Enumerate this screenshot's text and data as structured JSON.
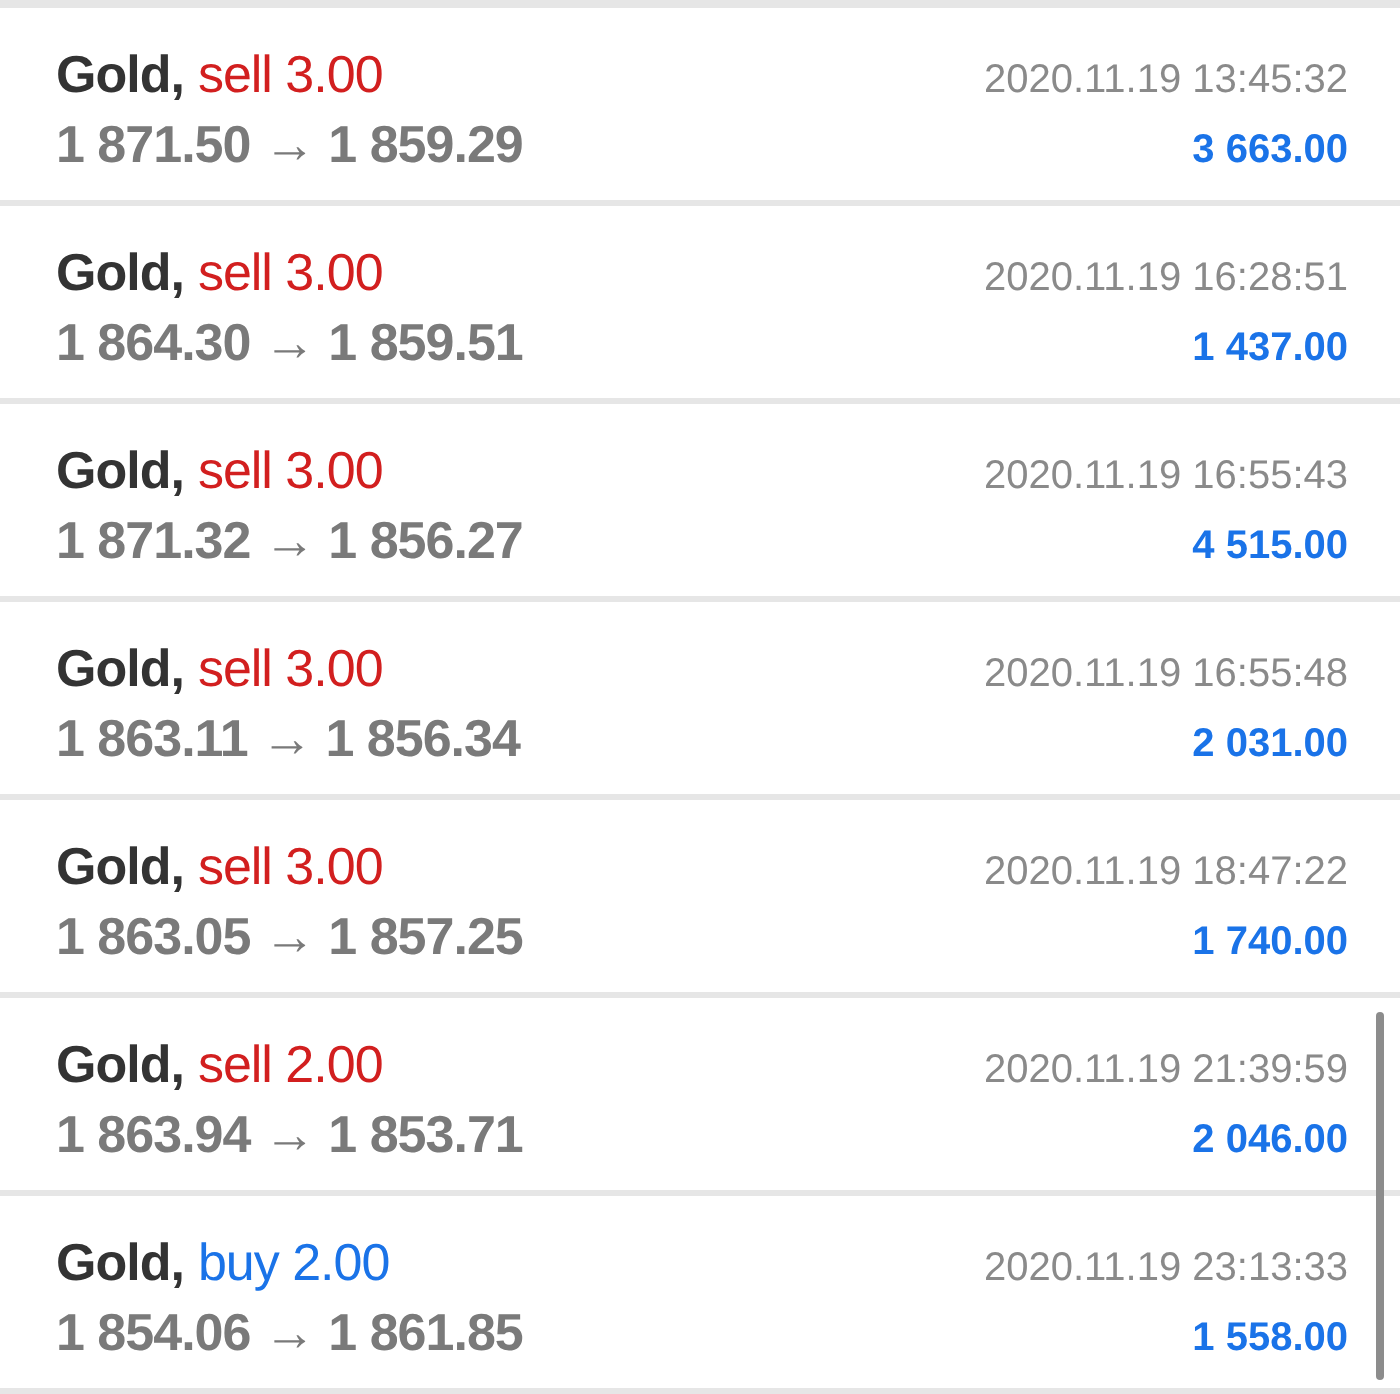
{
  "trades": [
    {
      "symbol": "Gold,",
      "kind": "sell",
      "order": "sell 3.00",
      "time": "2020.11.19 13:45:32",
      "prices": "1 871.50 → 1 859.29",
      "profit": "3 663.00"
    },
    {
      "symbol": "Gold,",
      "kind": "sell",
      "order": "sell 3.00",
      "time": "2020.11.19 16:28:51",
      "prices": "1 864.30 → 1 859.51",
      "profit": "1 437.00"
    },
    {
      "symbol": "Gold,",
      "kind": "sell",
      "order": "sell 3.00",
      "time": "2020.11.19 16:55:43",
      "prices": "1 871.32 → 1 856.27",
      "profit": "4 515.00"
    },
    {
      "symbol": "Gold,",
      "kind": "sell",
      "order": "sell 3.00",
      "time": "2020.11.19 16:55:48",
      "prices": "1 863.11 → 1 856.34",
      "profit": "2 031.00"
    },
    {
      "symbol": "Gold,",
      "kind": "sell",
      "order": "sell 3.00",
      "time": "2020.11.19 18:47:22",
      "prices": "1 863.05 → 1 857.25",
      "profit": "1 740.00"
    },
    {
      "symbol": "Gold,",
      "kind": "sell",
      "order": "sell 2.00",
      "time": "2020.11.19 21:39:59",
      "prices": "1 863.94 → 1 853.71",
      "profit": "2 046.00"
    },
    {
      "symbol": "Gold,",
      "kind": "buy",
      "order": "buy 2.00",
      "time": "2020.11.19 23:13:33",
      "prices": "1 854.06 → 1 861.85",
      "profit": "1 558.00"
    }
  ]
}
